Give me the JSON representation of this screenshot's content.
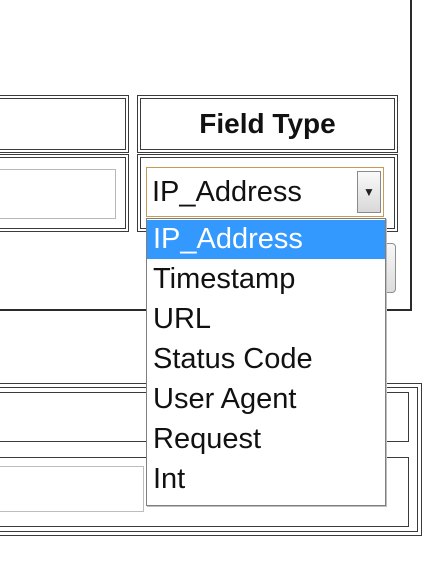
{
  "table": {
    "header": {
      "field_type_label": "Field Type"
    },
    "row": {
      "name_value": "",
      "field_type_selected": "IP_Address"
    }
  },
  "dropdown": {
    "options": [
      "IP_Address",
      "Timestamp",
      "URL",
      "Status Code",
      "User Agent",
      "Request",
      "Int"
    ],
    "highlighted_index": 0
  },
  "icons": {
    "select_arrow": "chevron-down-icon"
  },
  "colors": {
    "highlight": "#3399ff",
    "select_border": "#c99a56"
  }
}
